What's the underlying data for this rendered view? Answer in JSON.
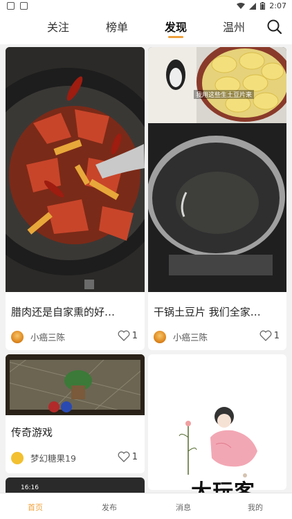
{
  "status_bar": {
    "time": "2:07"
  },
  "top_nav": {
    "tabs": [
      {
        "label": "关注"
      },
      {
        "label": "榜单"
      },
      {
        "label": "发现"
      },
      {
        "label": "温州"
      }
    ],
    "active_tab": "发现"
  },
  "feed": {
    "cards": [
      {
        "title": "腊肉还是自家熏的好…",
        "author": "小癌三陈",
        "likes": "1"
      },
      {
        "title": "干锅土豆片 我们全家…",
        "author": "小癌三陈",
        "likes": "1",
        "image_caption": "我用这些生土豆片来"
      },
      {
        "title": "传奇游戏",
        "author": "梦幻糖果19",
        "likes": "1"
      }
    ],
    "partial_card": {
      "time": "16:16"
    }
  },
  "watermark": "大玩客",
  "bottom_bar": {
    "tabs": [
      {
        "label": "首页"
      },
      {
        "label": "发布"
      },
      {
        "label": "消息"
      },
      {
        "label": "我的"
      }
    ],
    "active_tab": "首页"
  },
  "colors": {
    "accent": "#f0a13c",
    "background": "#f2f2f2"
  }
}
